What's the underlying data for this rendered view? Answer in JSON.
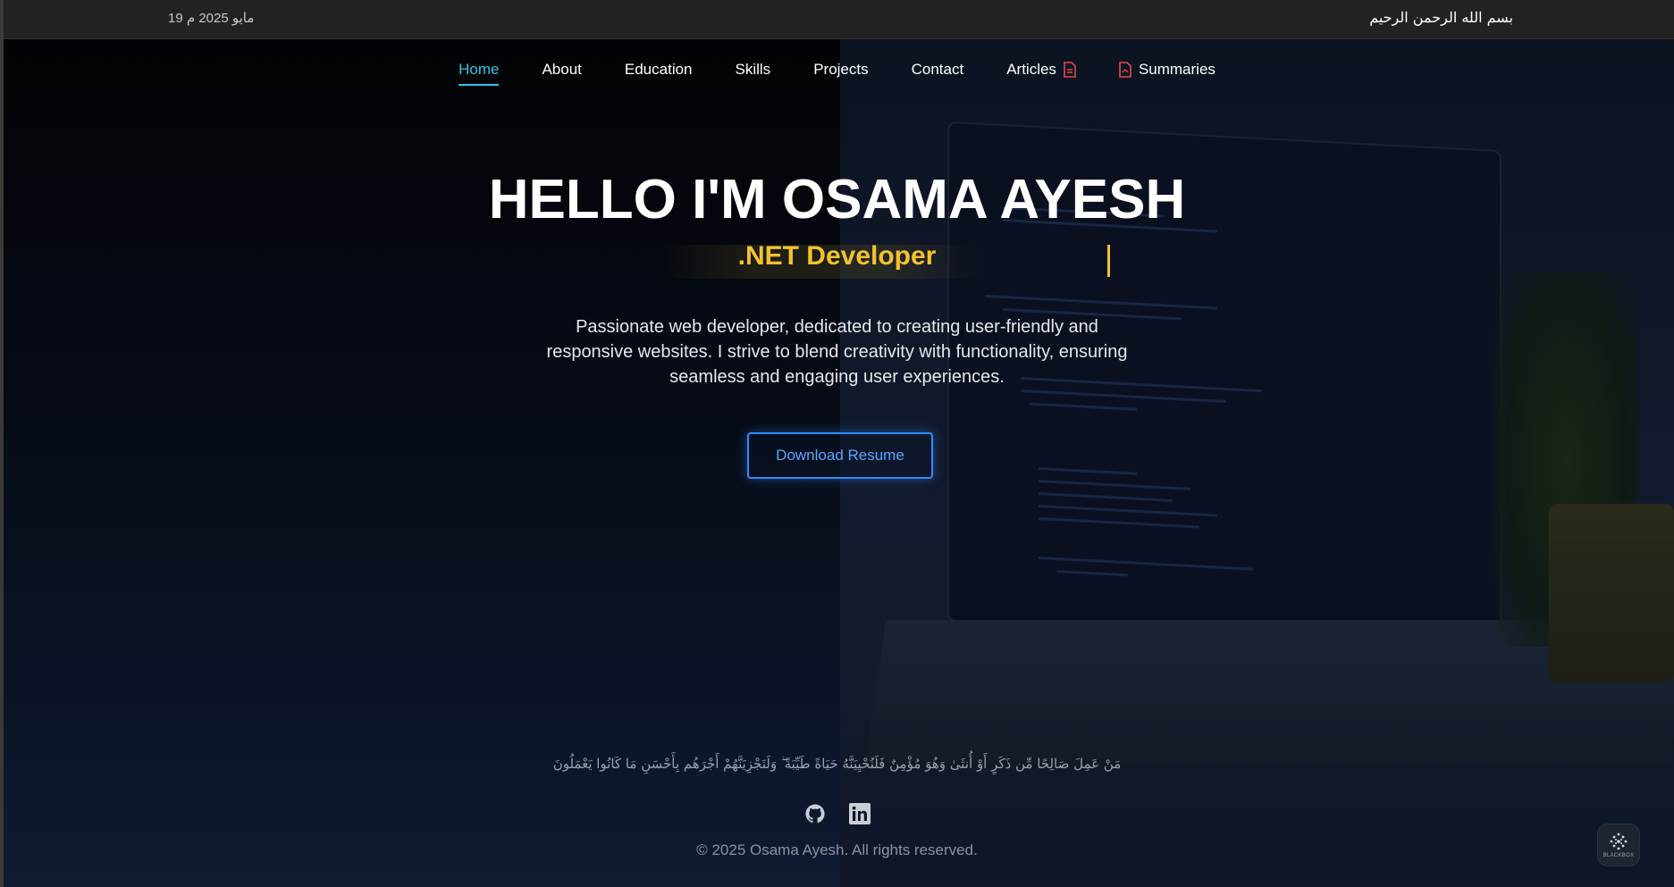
{
  "topbar": {
    "date": "19 مايو 2025 م",
    "basmala": "بسم الله الرحمن الرحيم"
  },
  "nav": {
    "items": [
      {
        "label": "Home",
        "active": true
      },
      {
        "label": "About"
      },
      {
        "label": "Education"
      },
      {
        "label": "Skills"
      },
      {
        "label": "Projects"
      },
      {
        "label": "Contact"
      },
      {
        "label": "Articles",
        "icon": "document-icon"
      },
      {
        "label": "Summaries",
        "icon": "pdf-document-icon"
      }
    ]
  },
  "hero": {
    "title": "HELLO I'M OSAMA AYESH",
    "role": ".NET Developer",
    "tagline": "Passionate web developer, dedicated to creating user-friendly and responsive websites. I strive to blend creativity with functionality, ensuring seamless and engaging user experiences.",
    "resume_button": "Download Resume"
  },
  "footer": {
    "verse": "مَنْ عَمِلَ صَالِحًا مِّن ذَكَرٍ أَوْ أُنثَىٰ وَهُوَ مُؤْمِنٌ فَلَنُحْيِيَنَّهُ حَيَاةً طَيِّبَةً ۖ وَلَنَجْزِيَنَّهُمْ أَجْرَهُم بِأَحْسَنِ مَا كَانُوا يَعْمَلُونَ",
    "socials": [
      {
        "icon": "github-icon"
      },
      {
        "icon": "linkedin-icon"
      }
    ],
    "copyright": "© 2025 Osama Ayesh. All rights reserved."
  },
  "widget": {
    "label": "BLACKBOX"
  },
  "colors": {
    "accent_cyan": "#2fc7e8",
    "accent_yellow": "#f2c230",
    "button_blue": "#2f8cff",
    "pdf_red": "#e5484d"
  }
}
